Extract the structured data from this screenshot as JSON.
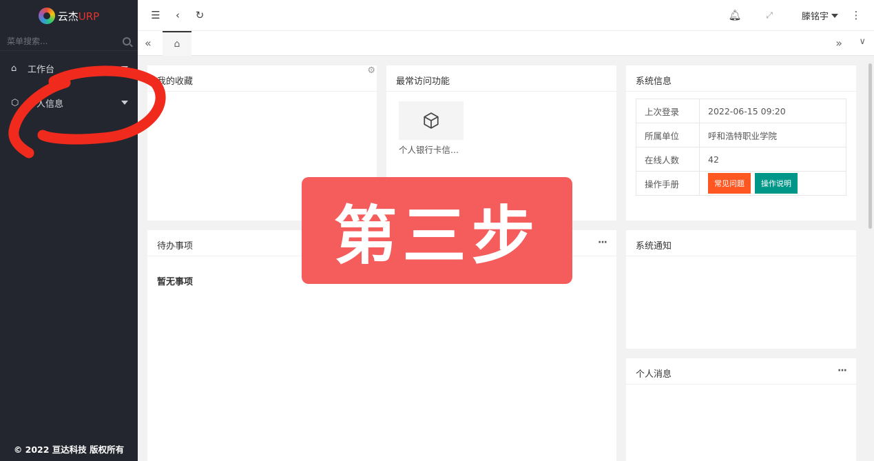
{
  "sidebar": {
    "logo_text": "云杰",
    "logo_accent": "URP",
    "search_placeholder": "菜单搜索...",
    "items": [
      {
        "label": "工作台"
      },
      {
        "label": "个人信息"
      }
    ],
    "copyright": "© 2022 亘达科技 版权所有"
  },
  "header": {
    "user_name": "滕铭宇",
    "icons": [
      "collapse-menu-icon",
      "back-icon",
      "refresh-icon",
      "bell-icon",
      "fullscreen-icon",
      "more-vertical-icon"
    ]
  },
  "tabbar": {
    "home_icon": "home-icon"
  },
  "favorites": {
    "title": "我的收藏"
  },
  "frequent": {
    "title": "最常访问功能",
    "items": [
      {
        "label": "个人银行卡信..."
      }
    ]
  },
  "system_info": {
    "title": "系统信息",
    "rows": [
      {
        "key": "上次登录",
        "value": "2022-06-15 09:20"
      },
      {
        "key": "所属单位",
        "value": "呼和浩特职业学院"
      },
      {
        "key": "在线人数",
        "value": "42"
      },
      {
        "key": "操作手册"
      }
    ],
    "faq_label": "常见问题",
    "manual_label": "操作说明",
    "colors": {
      "faq": "#ff5722",
      "manual": "#009688"
    }
  },
  "todo": {
    "title": "待办事项",
    "empty": "暂无事项"
  },
  "notice": {
    "title": "系统通知"
  },
  "messages": {
    "title": "个人消息"
  },
  "overlay": {
    "text": "第三步"
  }
}
